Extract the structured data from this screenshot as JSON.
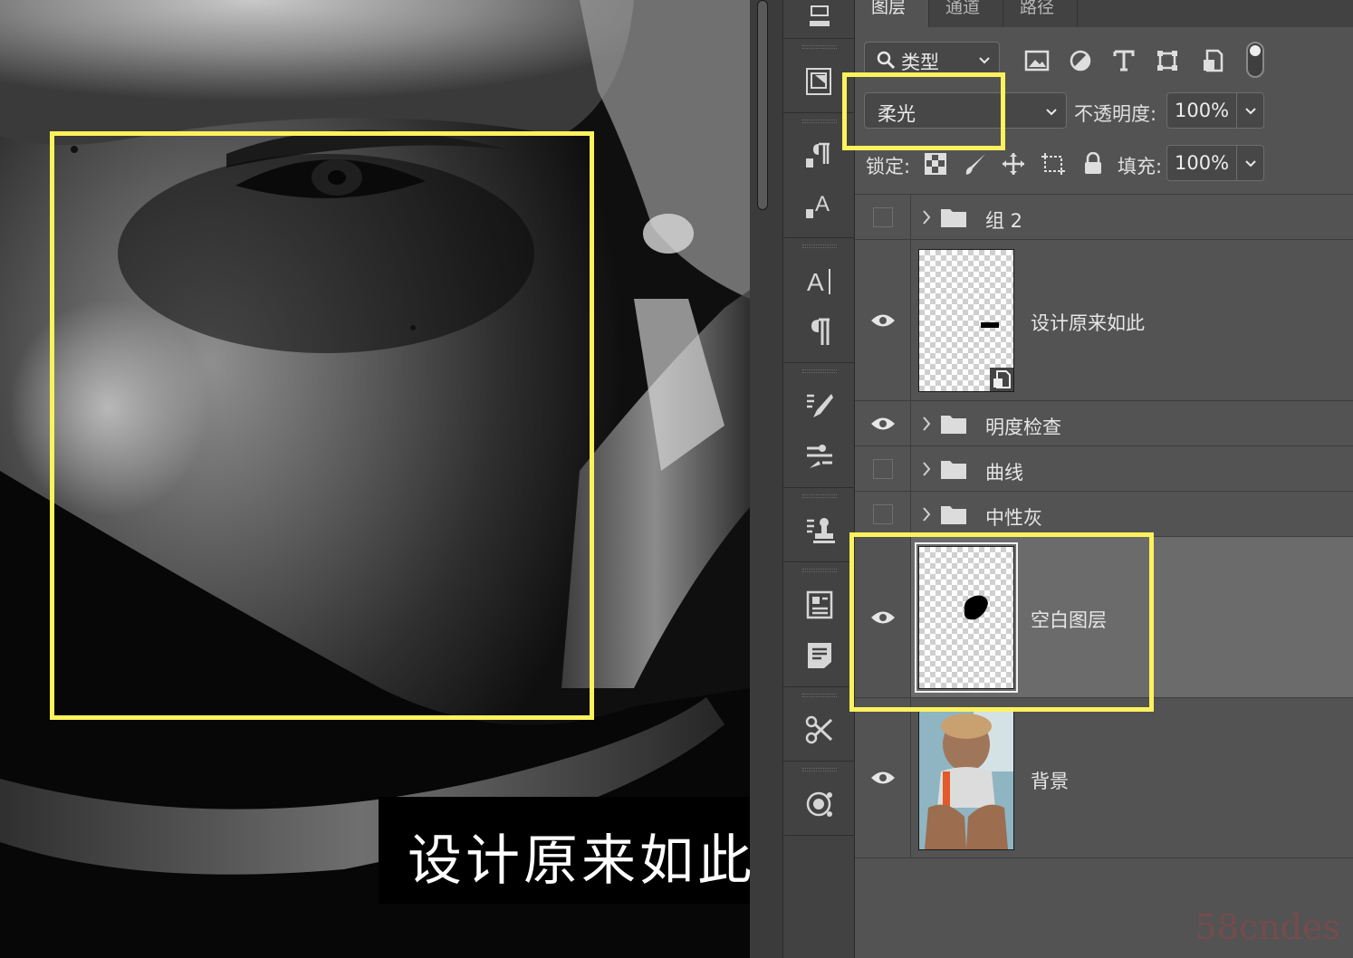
{
  "canvas": {
    "caption": "设计原来如此"
  },
  "tabs": [
    {
      "label": "图层",
      "active": true
    },
    {
      "label": "通道",
      "active": false
    },
    {
      "label": "路径",
      "active": false
    }
  ],
  "filter": {
    "kind_label": "类型",
    "icons": [
      "image-filter-icon",
      "adjustment-filter-icon",
      "type-filter-icon",
      "shape-filter-icon",
      "smart-object-filter-icon",
      "filter-toggle"
    ]
  },
  "blend": {
    "mode": "柔光",
    "opacity_label": "不透明度:",
    "opacity_value": "100%"
  },
  "lock": {
    "label": "锁定:",
    "fill_label": "填充:",
    "fill_value": "100%"
  },
  "layers": [
    {
      "name": "组 2",
      "type": "group",
      "visible": false
    },
    {
      "name": "设计原来如此",
      "type": "smart-object",
      "visible": true
    },
    {
      "name": "明度检查",
      "type": "group",
      "visible": true
    },
    {
      "name": "曲线",
      "type": "group",
      "visible": false
    },
    {
      "name": "中性灰",
      "type": "group",
      "visible": false
    },
    {
      "name": "空白图层",
      "type": "pixel",
      "visible": true,
      "selected": true
    },
    {
      "name": "背景",
      "type": "background",
      "visible": true
    }
  ],
  "watermark": "58cndes",
  "colors": {
    "highlight": "#fdf25c",
    "panel_bg": "#535353",
    "selected_row": "#6b6b6b"
  }
}
